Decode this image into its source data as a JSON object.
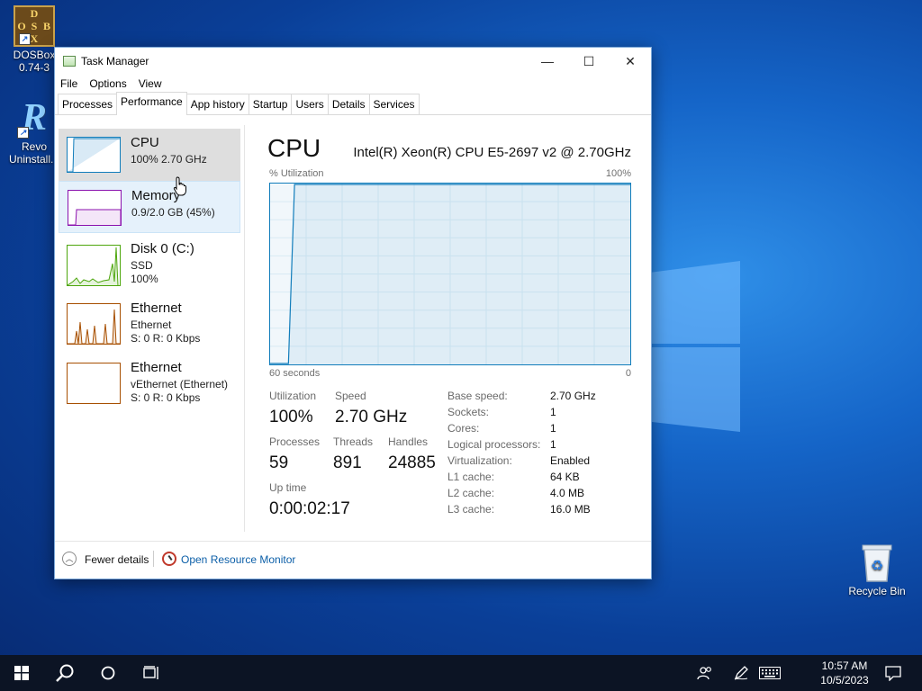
{
  "desktop": {
    "icons": [
      {
        "label": "DOSBox 0.74-3",
        "logo_letters": [
          "D",
          "O",
          "S",
          "B",
          "O",
          "X"
        ]
      },
      {
        "label": "Revo Uninstall...",
        "logo_letter": "R"
      },
      {
        "label": "Recycle Bin"
      }
    ]
  },
  "window": {
    "title": "Task Manager",
    "controls": {
      "minimize": "—",
      "maximize": "☐",
      "close": "✕"
    },
    "menu": [
      "File",
      "Options",
      "View"
    ],
    "tabs": [
      "Processes",
      "Performance",
      "App history",
      "Startup",
      "Users",
      "Details",
      "Services"
    ],
    "active_tab": "Performance"
  },
  "sidebar": {
    "items": [
      {
        "title": "CPU",
        "line1": "100%  2.70 GHz",
        "color": "#117dbb",
        "selected": true
      },
      {
        "title": "Memory",
        "line1": "0.9/2.0 GB (45%)",
        "color": "#8b12ae",
        "hovered": true
      },
      {
        "title": "Disk 0 (C:)",
        "line1": "SSD",
        "line2": "100%",
        "color": "#4da60c"
      },
      {
        "title": "Ethernet",
        "line1": "Ethernet",
        "line2": "S: 0  R: 0 Kbps",
        "color": "#a74f01"
      },
      {
        "title": "Ethernet",
        "line1": "vEthernet (Ethernet)",
        "line2": "S: 0  R: 0 Kbps",
        "color": "#a74f01"
      }
    ]
  },
  "main": {
    "heading": "CPU",
    "model": "Intel(R) Xeon(R) CPU E5-2697 v2 @ 2.70GHz",
    "graph": {
      "y_label": "% Utilization",
      "y_max_label": "100%",
      "x_left_label": "60 seconds",
      "x_right_label": "0",
      "utilization_series_percent": [
        0,
        0,
        0,
        0,
        100,
        100,
        100,
        100,
        100,
        100,
        100,
        100,
        100,
        100,
        100,
        100,
        100,
        100,
        100,
        100,
        100,
        100,
        100,
        100,
        100,
        100,
        100,
        100,
        100,
        100,
        100,
        100,
        100,
        100,
        100,
        100,
        100,
        100,
        100,
        100,
        100,
        100,
        100,
        100,
        100,
        100,
        100,
        100,
        100,
        100,
        100,
        100,
        100,
        100,
        100,
        100,
        100,
        100,
        100,
        100
      ]
    },
    "stats": {
      "utilization_label": "Utilization",
      "utilization": "100%",
      "speed_label": "Speed",
      "speed": "2.70 GHz",
      "processes_label": "Processes",
      "processes": "59",
      "threads_label": "Threads",
      "threads": "891",
      "handles_label": "Handles",
      "handles": "24885",
      "uptime_label": "Up time",
      "uptime": "0:00:02:17"
    },
    "details": [
      {
        "label": "Base speed:",
        "value": "2.70 GHz"
      },
      {
        "label": "Sockets:",
        "value": "1"
      },
      {
        "label": "Cores:",
        "value": "1"
      },
      {
        "label": "Logical processors:",
        "value": "1"
      },
      {
        "label": "Virtualization:",
        "value": "Enabled"
      },
      {
        "label": "L1 cache:",
        "value": "64 KB"
      },
      {
        "label": "L2 cache:",
        "value": "4.0 MB"
      },
      {
        "label": "L3 cache:",
        "value": "16.0 MB"
      }
    ]
  },
  "footer": {
    "fewer_details": "Fewer details",
    "resource_monitor": "Open Resource Monitor"
  },
  "taskbar": {
    "time": "10:57 AM",
    "date": "10/5/2023"
  }
}
